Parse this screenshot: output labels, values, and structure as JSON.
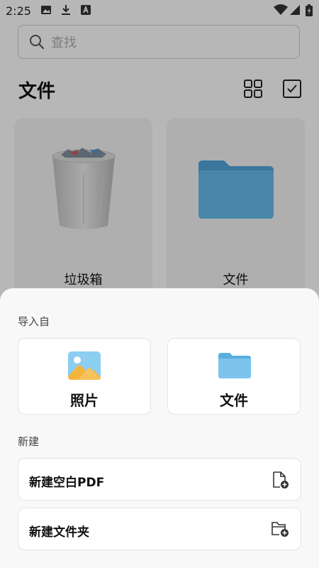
{
  "status_bar": {
    "time": "2:25"
  },
  "search": {
    "placeholder": "查找",
    "value": ""
  },
  "header": {
    "title": "文件"
  },
  "folders": [
    {
      "label": "垃圾箱",
      "icon": "trash-icon"
    },
    {
      "label": "文件",
      "icon": "folder-icon"
    }
  ],
  "sheet": {
    "import_label": "导入自",
    "import_options": [
      {
        "label": "照片",
        "icon": "photo-icon"
      },
      {
        "label": "文件",
        "icon": "folder-icon"
      }
    ],
    "new_label": "新建",
    "new_options": [
      {
        "label": "新建空白PDF",
        "icon": "add-document-icon"
      },
      {
        "label": "新建文件夹",
        "icon": "add-folder-icon"
      }
    ]
  },
  "colors": {
    "folder_blue": "#5aaee0",
    "accent_orange": "#f4b43c"
  }
}
